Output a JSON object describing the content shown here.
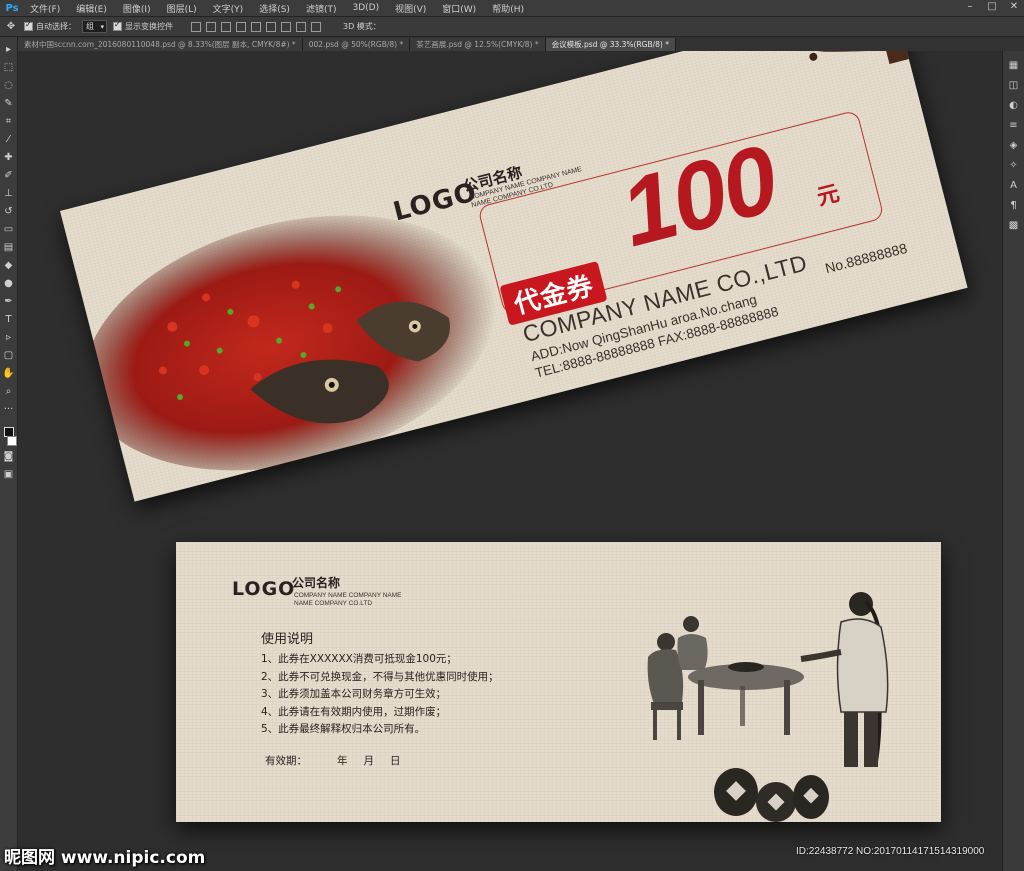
{
  "app": {
    "logo": "Ps",
    "menu": [
      "文件(F)",
      "编辑(E)",
      "图像(I)",
      "图层(L)",
      "文字(Y)",
      "选择(S)",
      "滤镜(T)",
      "3D(D)",
      "视图(V)",
      "窗口(W)",
      "帮助(H)"
    ]
  },
  "options": {
    "auto_select_label": "自动选择：",
    "auto_select_value": "组",
    "show_transform_label": "显示变换控件",
    "mode_label": "3D 模式："
  },
  "tabs": [
    "素材中国sccnn.com_2016080110048.psd @ 8.33%(图层 副本, CMYK/8#) *",
    "002.psd @ 50%(RGB/8) *",
    "茶艺画展.psd @ 12.5%(CMYK/8) *",
    "会议模板.psd @ 33.3%(RGB/8) *"
  ],
  "front": {
    "logo": "LOGO",
    "company_cn": "公司名称",
    "company_small": [
      "COMPANY NAME COMPANY NAME",
      "NAME COMPANY CO.LTD"
    ],
    "amount": "100",
    "unit": "元",
    "badge": "代金券",
    "company_en": "COMPANY NAME CO.,LTD",
    "address_lines": [
      "ADD:Now QingShanHu aroa.No.chang",
      "TEL:8888-88888888   FAX:8888-88888888"
    ],
    "serial": "No.88888888"
  },
  "back": {
    "logo": "LOGO",
    "company_cn": "公司名称",
    "company_small": [
      "COMPANY NAME COMPANY NAME",
      "NAME COMPANY CO.LTD"
    ],
    "rules_title": "使用说明",
    "rules": [
      "1、此券在XXXXXX消费可抵现金100元；",
      "2、此券不可兑换现金，不得与其他优惠同时使用；",
      "3、此券须加盖本公司财务章方可生效；",
      "4、此券请在有效期内使用，过期作废；",
      "5、此券最终解释权归本公司所有。"
    ],
    "validity_label": "有效期：",
    "validity_year": "年",
    "validity_month": "月",
    "validity_day": "日"
  },
  "watermark": {
    "site": "昵图网 www.nipic.com",
    "id": "ID:22438772 NO:20170114171514319000"
  },
  "colors": {
    "accent_red": "#c8171e",
    "paper": "#e5dccd",
    "ps_blue": "#31a8ff"
  }
}
